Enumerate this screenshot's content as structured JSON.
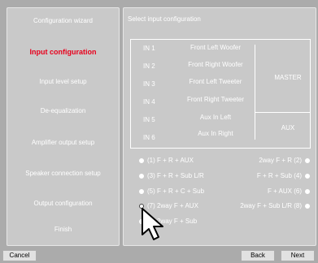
{
  "sidebar": {
    "items": [
      {
        "label": "Configuration wizard"
      },
      {
        "label": "Input configuration",
        "active": true
      },
      {
        "label": "Input level setup"
      },
      {
        "label": "De-equalization"
      },
      {
        "label": "Amplifier output setup"
      },
      {
        "label": "Speaker connection setup"
      },
      {
        "label": "Output configuration"
      },
      {
        "label": "Finish"
      }
    ]
  },
  "panel": {
    "title": "Select input configuration",
    "inputs": [
      {
        "in": "IN 1",
        "name": "Front Left Woofer"
      },
      {
        "in": "IN 2",
        "name": "Front Right Woofer"
      },
      {
        "in": "IN 3",
        "name": "Front Left Tweeter"
      },
      {
        "in": "IN 4",
        "name": "Front Right Tweeter"
      },
      {
        "in": "IN 5",
        "name": "Aux In Left"
      },
      {
        "in": "IN 6",
        "name": "Aux In Right"
      }
    ],
    "groups": {
      "master": "MASTER",
      "aux": "AUX"
    },
    "options": [
      {
        "label": "(1) F + R + AUX",
        "checked": false
      },
      {
        "label": "2way F + R (2)",
        "checked": false
      },
      {
        "label": "(3) F + R + Sub L/R",
        "checked": false
      },
      {
        "label": "F + R + Sub (4)",
        "checked": false
      },
      {
        "label": "(5) F + R + C + Sub",
        "checked": false
      },
      {
        "label": "F + AUX (6)",
        "checked": false
      },
      {
        "label": "(7) 2way F + AUX",
        "checked": true
      },
      {
        "label": "2way F + Sub L/R (8)",
        "checked": false
      },
      {
        "label": "(9) 2way F + Sub",
        "checked": false
      }
    ]
  },
  "footer": {
    "cancel_label": "Cancel",
    "back_label": "Back",
    "next_label": "Next"
  },
  "colors": {
    "background": "#ababab",
    "panel": "#c9c9c9",
    "active_text": "#e8001c",
    "text": "#ffffff"
  }
}
